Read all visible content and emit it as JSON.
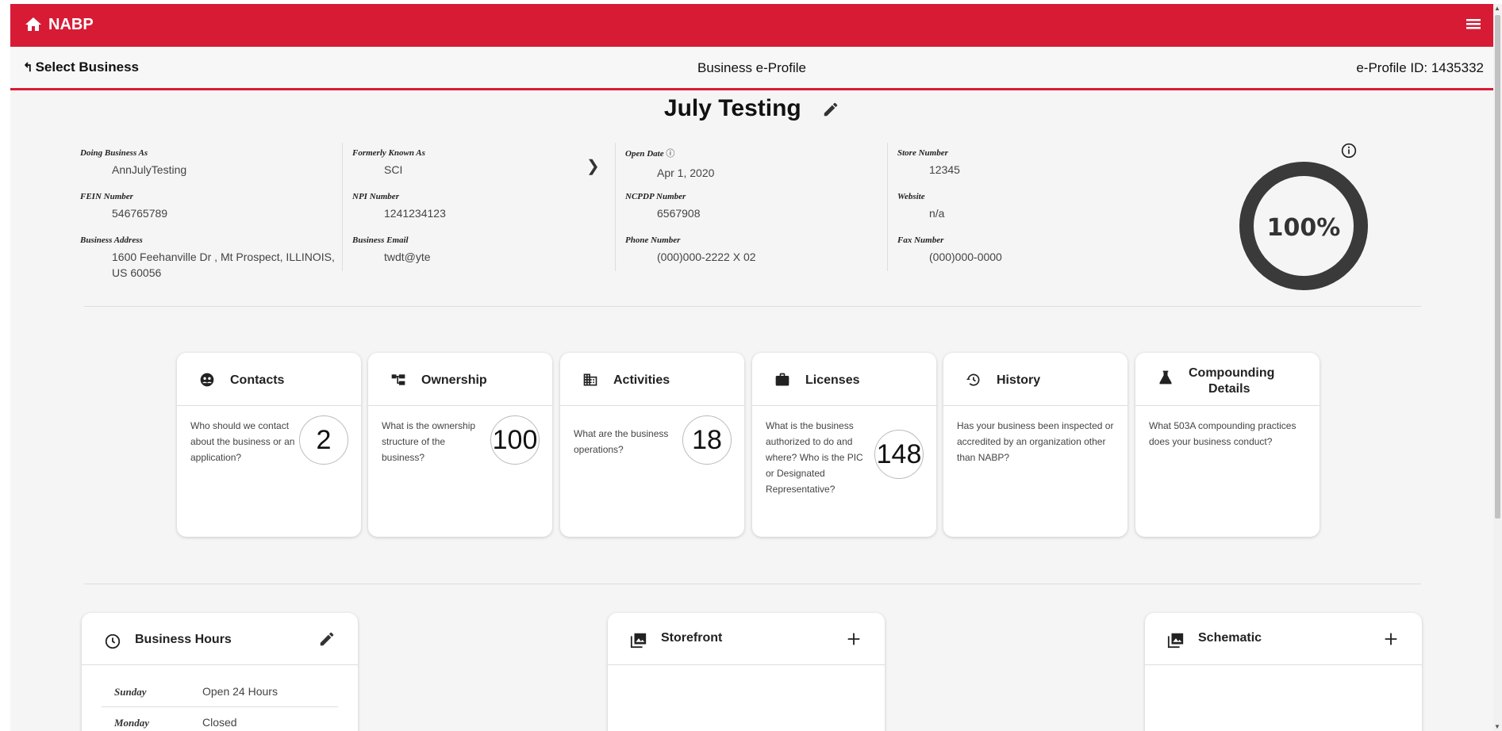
{
  "header": {
    "brand": "NABP"
  },
  "subheader": {
    "back_label": "Select Business",
    "title": "Business e-Profile",
    "profile_id": "e-Profile ID: 1435332"
  },
  "business": {
    "name": "July Testing"
  },
  "fields": {
    "dba": {
      "label": "Doing Business As",
      "value": "AnnJulyTesting"
    },
    "fka": {
      "label": "Formerly Known As",
      "value": "SCI"
    },
    "open_date": {
      "label": "Open Date",
      "value": "Apr 1, 2020"
    },
    "store_number": {
      "label": "Store Number",
      "value": "12345"
    },
    "fein": {
      "label": "FEIN Number",
      "value": "546765789"
    },
    "npi": {
      "label": "NPI Number",
      "value": "1241234123"
    },
    "ncpdp": {
      "label": "NCPDP Number",
      "value": "6567908"
    },
    "website": {
      "label": "Website",
      "value": "n/a"
    },
    "address": {
      "label": "Business Address",
      "line1": "1600 Feehanville Dr , Mt Prospect, ILLINOIS,",
      "line2": "US 60056"
    },
    "email": {
      "label": "Business Email",
      "value": "twdt@yte"
    },
    "phone": {
      "label": "Phone Number",
      "value": "(000)000-2222 X 02"
    },
    "fax": {
      "label": "Fax Number",
      "value": "(000)000-0000"
    }
  },
  "completion": {
    "percent": 100,
    "label": "100%"
  },
  "cards": [
    {
      "title": "Contacts",
      "icon": "contacts-icon",
      "desc": "Who should we contact about the business or an application?",
      "count": "2"
    },
    {
      "title": "Ownership",
      "icon": "ownership-icon",
      "desc": "What is the ownership structure of the business?",
      "count": "100"
    },
    {
      "title": "Activities",
      "icon": "activities-icon",
      "desc": "What are the business operations?",
      "count": "18"
    },
    {
      "title": "Licenses",
      "icon": "licenses-icon",
      "desc": "What is the business authorized to do and where? Who is the PIC or Designated Representative?",
      "count": "148"
    },
    {
      "title": "History",
      "icon": "history-icon",
      "desc": "Has your business been inspected or accredited by an organization other than NABP?",
      "count": ""
    },
    {
      "title_line1": "Compounding",
      "title_line2": "Details",
      "icon": "flask-icon",
      "desc": "What 503A compounding practices does your business conduct?",
      "count": ""
    }
  ],
  "business_hours": {
    "title": "Business Hours",
    "rows": [
      {
        "day": "Sunday",
        "hours": "Open 24 Hours"
      },
      {
        "day": "Monday",
        "hours": "Closed"
      }
    ]
  },
  "storefront": {
    "title": "Storefront"
  },
  "schematic": {
    "title": "Schematic"
  },
  "colors": {
    "brand_red": "#d81b35",
    "background": "#f5f5f5",
    "donut": "#3a3a3a"
  }
}
